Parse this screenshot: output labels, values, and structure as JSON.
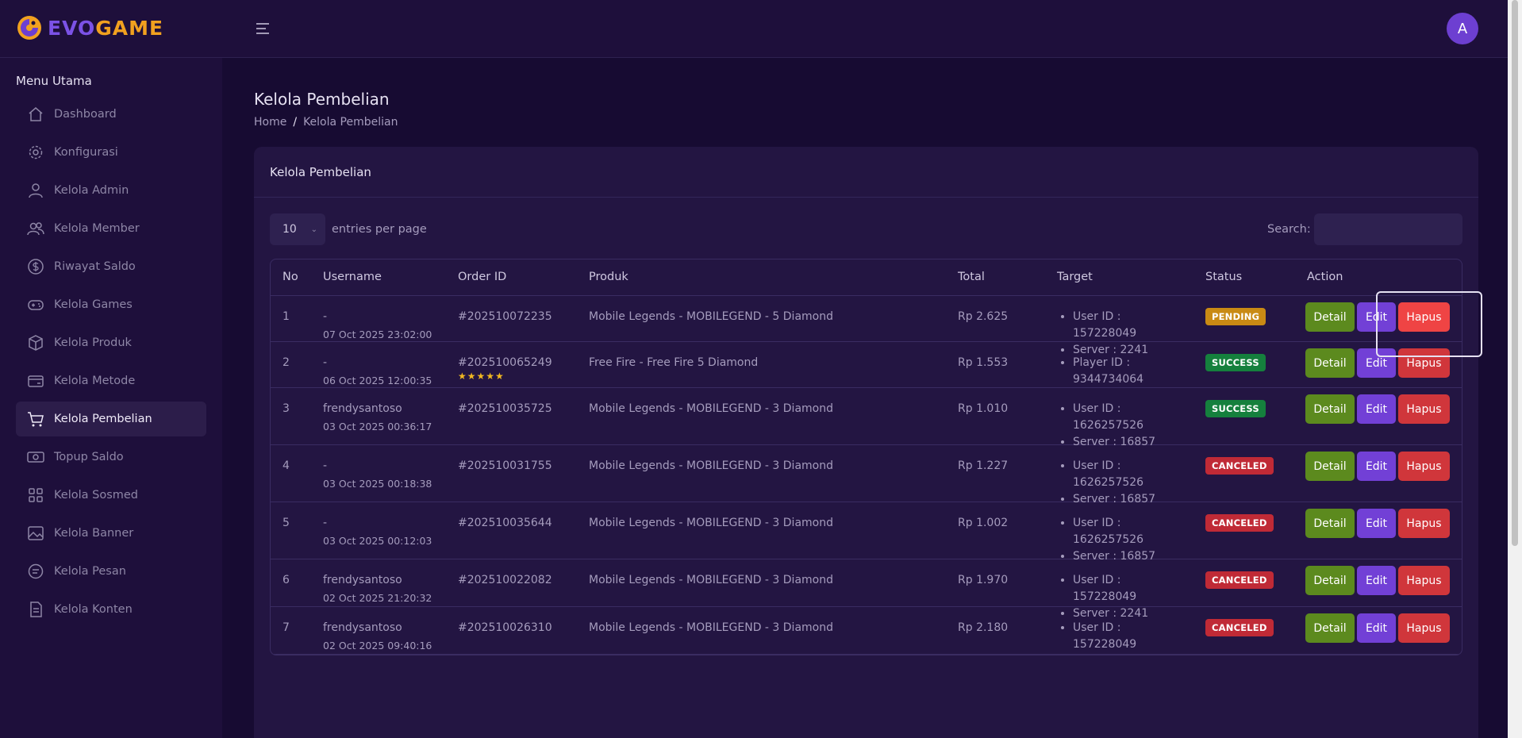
{
  "brand": {
    "part1": "EVO",
    "part2": "GAME"
  },
  "header": {
    "avatar_letter": "A"
  },
  "sidebar": {
    "title": "Menu Utama",
    "items": [
      {
        "label": "Dashboard",
        "icon": "home-icon"
      },
      {
        "label": "Konfigurasi",
        "icon": "gear-icon"
      },
      {
        "label": "Kelola Admin",
        "icon": "user-icon"
      },
      {
        "label": "Kelola Member",
        "icon": "users-icon"
      },
      {
        "label": "Riwayat Saldo",
        "icon": "dollar-icon"
      },
      {
        "label": "Kelola Games",
        "icon": "gamepad-icon"
      },
      {
        "label": "Kelola Produk",
        "icon": "box-icon"
      },
      {
        "label": "Kelola Metode",
        "icon": "card-icon"
      },
      {
        "label": "Kelola Pembelian",
        "icon": "cart-icon",
        "active": true
      },
      {
        "label": "Topup Saldo",
        "icon": "money-icon"
      },
      {
        "label": "Kelola Sosmed",
        "icon": "grid-icon"
      },
      {
        "label": "Kelola Banner",
        "icon": "image-icon"
      },
      {
        "label": "Kelola Pesan",
        "icon": "chat-icon"
      },
      {
        "label": "Kelola Konten",
        "icon": "document-icon"
      }
    ]
  },
  "page": {
    "title": "Kelola Pembelian",
    "breadcrumb": {
      "home": "Home",
      "sep": "/",
      "current": "Kelola Pembelian"
    }
  },
  "card": {
    "title": "Kelola Pembelian",
    "entries_value": "10",
    "entries_label": "entries per page",
    "search_label": "Search:",
    "search_value": ""
  },
  "table": {
    "headers": {
      "no": "No",
      "username": "Username",
      "order_id": "Order ID",
      "produk": "Produk",
      "total": "Total",
      "target": "Target",
      "status": "Status",
      "action": "Action"
    },
    "buttons": {
      "detail": "Detail",
      "edit": "Edit",
      "hapus": "Hapus"
    },
    "rows": [
      {
        "no": "1",
        "username": "-",
        "date": "07 Oct 2025 23:02:00",
        "order_id": "#202510072235",
        "produk": "Mobile Legends - MOBILEGEND - 5 Diamond",
        "total": "Rp 2.625",
        "targets": [
          "User ID : 157228049",
          "Server : 2241"
        ],
        "status": "PENDING"
      },
      {
        "no": "2",
        "username": "-",
        "date": "06 Oct 2025 12:00:35",
        "order_id": "#202510065249",
        "stars": "★★★★★",
        "produk": "Free Fire - Free Fire 5 Diamond",
        "total": "Rp 1.553",
        "targets": [
          "Player ID : 9344734064"
        ],
        "status": "SUCCESS"
      },
      {
        "no": "3",
        "username": "frendysantoso",
        "date": "03 Oct 2025 00:36:17",
        "order_id": "#202510035725",
        "produk": "Mobile Legends - MOBILEGEND - 3 Diamond",
        "total": "Rp 1.010",
        "targets": [
          "User ID : 1626257526",
          "Server : 16857"
        ],
        "status": "SUCCESS"
      },
      {
        "no": "4",
        "username": "-",
        "date": "03 Oct 2025 00:18:38",
        "order_id": "#202510031755",
        "produk": "Mobile Legends - MOBILEGEND - 3 Diamond",
        "total": "Rp 1.227",
        "targets": [
          "User ID : 1626257526",
          "Server : 16857"
        ],
        "status": "CANCELED"
      },
      {
        "no": "5",
        "username": "-",
        "date": "03 Oct 2025 00:12:03",
        "order_id": "#202510035644",
        "produk": "Mobile Legends - MOBILEGEND - 3 Diamond",
        "total": "Rp 1.002",
        "targets": [
          "User ID : 1626257526",
          "Server : 16857"
        ],
        "status": "CANCELED"
      },
      {
        "no": "6",
        "username": "frendysantoso",
        "date": "02 Oct 2025 21:20:32",
        "order_id": "#202510022082",
        "produk": "Mobile Legends - MOBILEGEND - 3 Diamond",
        "total": "Rp 1.970",
        "targets": [
          "User ID : 157228049",
          "Server : 2241"
        ],
        "status": "CANCELED"
      },
      {
        "no": "7",
        "username": "frendysantoso",
        "date": "02 Oct 2025 09:40:16",
        "order_id": "#202510026310",
        "produk": "Mobile Legends - MOBILEGEND - 3 Diamond",
        "total": "Rp 2.180",
        "targets": [
          "User ID : 157228049",
          "Server : 2241"
        ],
        "status": "CANCELED"
      }
    ]
  },
  "colors": {
    "pending": "#c98a14",
    "success": "#15803d",
    "canceled": "#c02a36"
  }
}
